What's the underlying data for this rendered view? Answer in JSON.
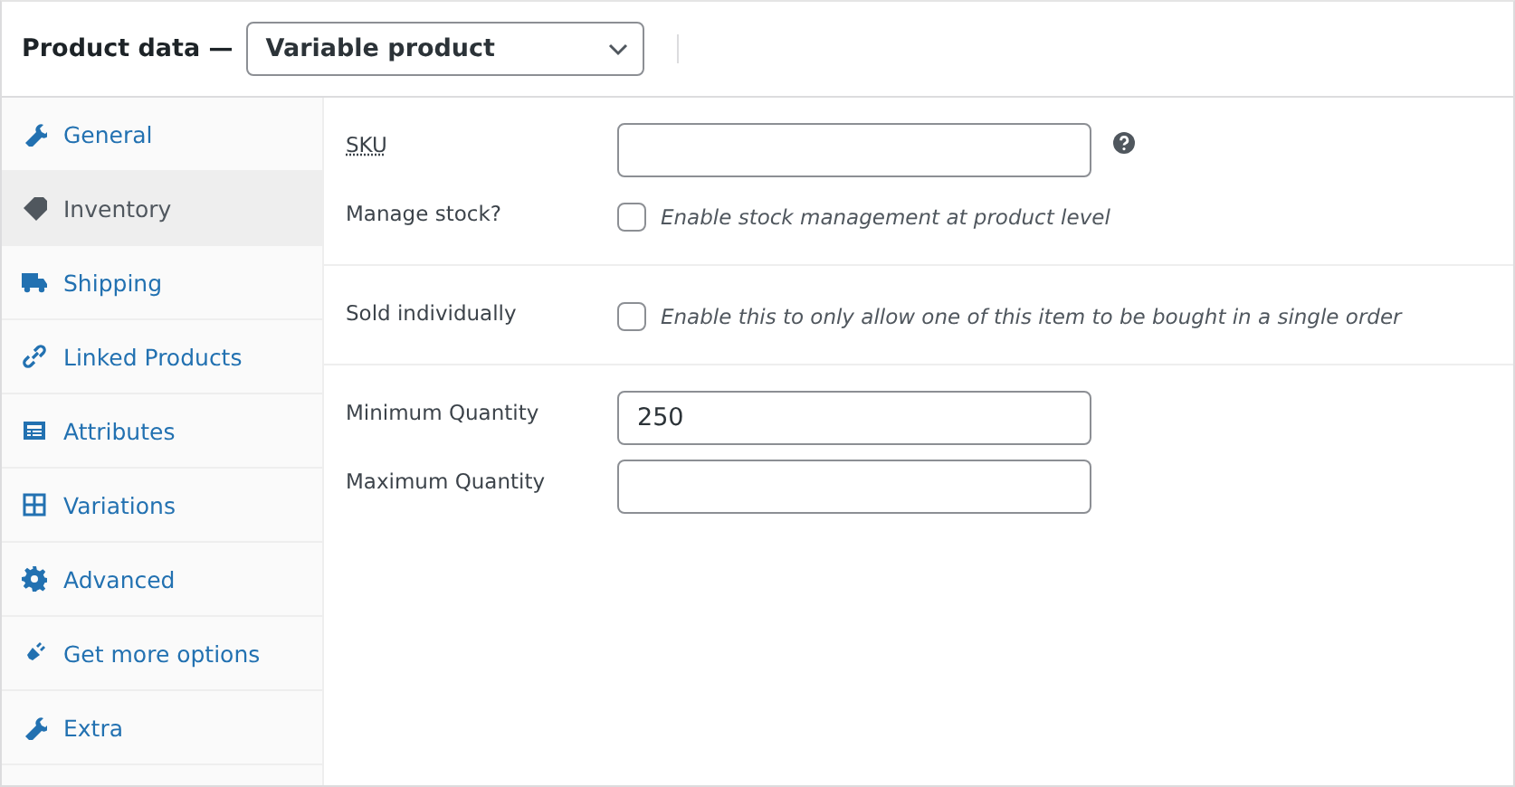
{
  "header": {
    "title": "Product data —",
    "product_type": "Variable product"
  },
  "tabs": [
    {
      "label": "General",
      "selected": false
    },
    {
      "label": "Inventory",
      "selected": true
    },
    {
      "label": "Shipping",
      "selected": false
    },
    {
      "label": "Linked Products",
      "selected": false
    },
    {
      "label": "Attributes",
      "selected": false
    },
    {
      "label": "Variations",
      "selected": false
    },
    {
      "label": "Advanced",
      "selected": false
    },
    {
      "label": "Get more options",
      "selected": false
    },
    {
      "label": "Extra",
      "selected": false
    }
  ],
  "groups": [
    {
      "fields": [
        {
          "kind": "text",
          "label": "SKU",
          "help": true
        },
        {
          "kind": "checkbox",
          "label": "Manage stock?",
          "description": "Enable stock management at product level",
          "checked": false
        }
      ]
    },
    {
      "fields": [
        {
          "kind": "checkbox",
          "label": "Sold individually",
          "description": "Enable this to only allow one of this item to be bought in a single order",
          "checked": false
        }
      ]
    },
    {
      "fields": [
        {
          "kind": "text",
          "label": "Minimum Quantity",
          "value": "250",
          "help": false
        },
        {
          "kind": "text",
          "label": "Maximum Quantity",
          "help": false
        }
      ]
    }
  ]
}
